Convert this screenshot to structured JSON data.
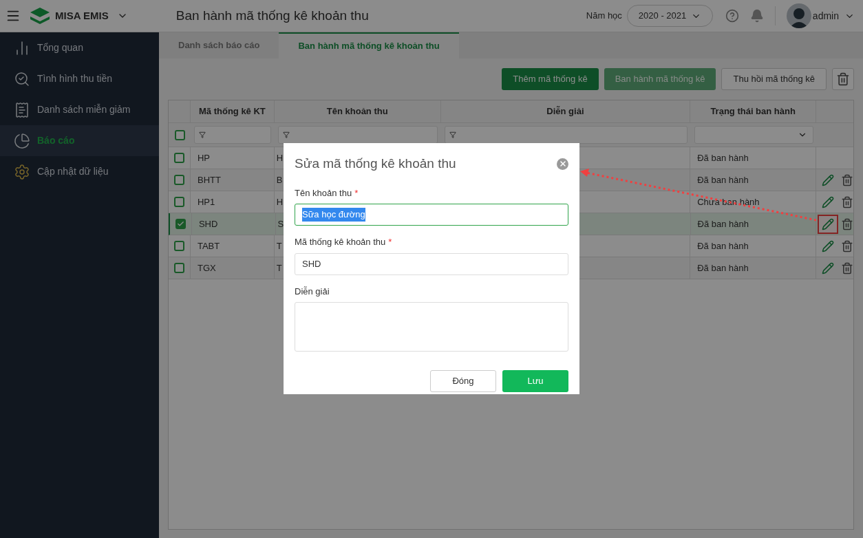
{
  "header": {
    "brand": "MISA EMIS",
    "page_title": "Ban hành mã thống kê khoản thu",
    "year_label": "Năm học",
    "year_value": "2020 - 2021",
    "user": "admin"
  },
  "sidebar": {
    "items": [
      {
        "kind": "chart",
        "label": "Tổng quan",
        "selected": false
      },
      {
        "kind": "money",
        "label": "Tình hình thu tiền",
        "selected": false
      },
      {
        "kind": "discount",
        "label": "Danh sách miễn giảm",
        "selected": false
      },
      {
        "kind": "pie",
        "label": "Báo cáo",
        "selected": true
      },
      {
        "kind": "gear",
        "label": "Cập nhật dữ liệu",
        "selected": false
      }
    ]
  },
  "tabs": [
    {
      "label": "Danh sách báo cáo",
      "selected": false
    },
    {
      "label": "Ban hành mã thống kê khoản thu",
      "selected": true
    }
  ],
  "toolbar": [
    {
      "label": "Thêm mã thống kê",
      "kind": "primary",
      "disabled": false
    },
    {
      "label": "Ban hành mã thống kê",
      "kind": "primary",
      "disabled": true
    },
    {
      "label": "Thu hồi mã thống kê",
      "kind": "outline",
      "disabled": false
    }
  ],
  "table": {
    "all_checked": false,
    "columns": [
      "Mã thống kê KT",
      "Tên khoản thu",
      "Diễn giải",
      "Trạng thái ban hành"
    ],
    "rows": [
      {
        "code": "HP",
        "name": "H",
        "status": "Đã ban hành",
        "checked": false,
        "selected": false,
        "actions": false
      },
      {
        "code": "BHTT",
        "name": "B",
        "status": "Đã ban hành",
        "checked": false,
        "selected": false,
        "actions": true,
        "callout": false
      },
      {
        "code": "HP1",
        "name": "H",
        "status": "Chưa ban hành",
        "checked": false,
        "selected": false,
        "actions": true,
        "callout": false
      },
      {
        "code": "SHD",
        "name": "S",
        "status": "Đã ban hành",
        "checked": true,
        "selected": true,
        "actions": true,
        "callout": true
      },
      {
        "code": "TABT",
        "name": "T",
        "status": "Đã ban hành",
        "checked": false,
        "selected": false,
        "actions": true,
        "callout": false
      },
      {
        "code": "TGX",
        "name": "T",
        "status": "Đã ban hành",
        "checked": false,
        "selected": false,
        "actions": true,
        "callout": false
      }
    ]
  },
  "dialog": {
    "title": "Sửa mã thống kê khoản thu",
    "fields": [
      {
        "label": "Tên khoản thu",
        "required_mark": "*",
        "value": "Sữa học đường",
        "focused": true,
        "kind": "input"
      },
      {
        "label": "Mã thống kê khoản thu",
        "required_mark": "*",
        "value": "SHD",
        "focused": false,
        "kind": "input"
      },
      {
        "label": "Diễn giải",
        "focused": false,
        "kind": "textarea"
      }
    ],
    "buttons": [
      {
        "label": "Đóng",
        "kind": "secondary"
      },
      {
        "label": "Lưu",
        "kind": "primary"
      }
    ]
  }
}
